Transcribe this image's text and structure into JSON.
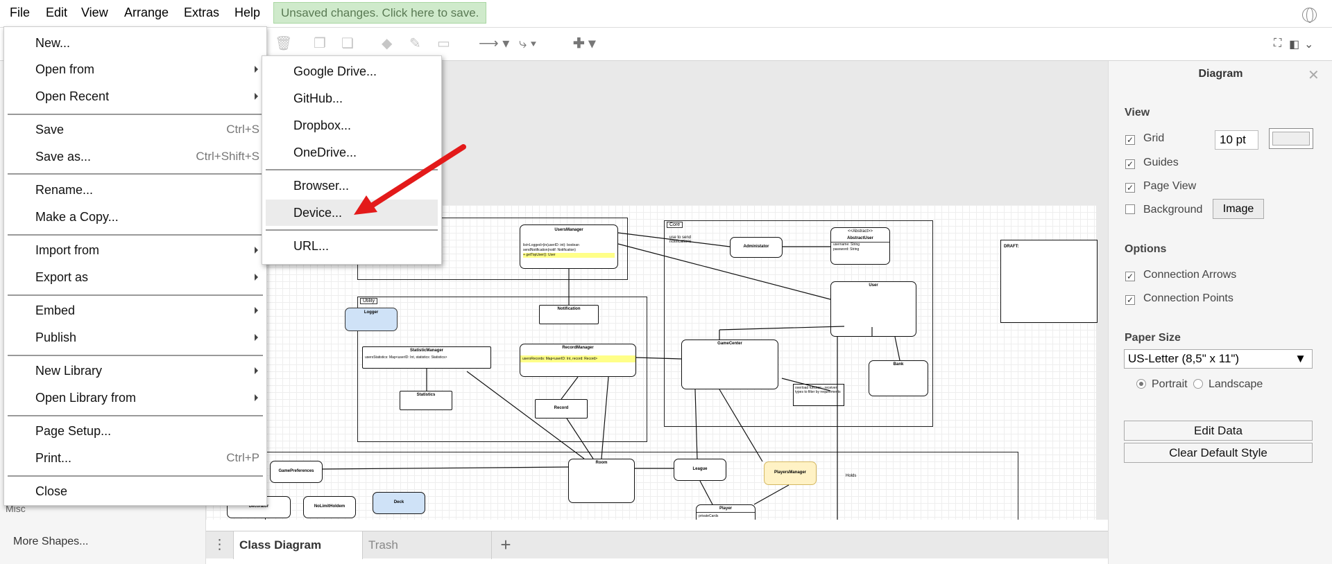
{
  "menubar": {
    "items": [
      "File",
      "Edit",
      "View",
      "Arrange",
      "Extras",
      "Help"
    ],
    "unsaved": "Unsaved changes. Click here to save."
  },
  "file_menu": {
    "new": "New...",
    "open_from": "Open from",
    "open_recent": "Open Recent",
    "save": "Save",
    "save_shortcut": "Ctrl+S",
    "save_as": "Save as...",
    "save_as_shortcut": "Ctrl+Shift+S",
    "rename": "Rename...",
    "make_copy": "Make a Copy...",
    "import_from": "Import from",
    "export_as": "Export as",
    "embed": "Embed",
    "publish": "Publish",
    "new_library": "New Library",
    "open_library_from": "Open Library from",
    "page_setup": "Page Setup...",
    "print": "Print...",
    "print_shortcut": "Ctrl+P",
    "close": "Close"
  },
  "open_from_submenu": {
    "google_drive": "Google Drive...",
    "github": "GitHub...",
    "dropbox": "Dropbox...",
    "onedrive": "OneDrive...",
    "browser": "Browser...",
    "device": "Device...",
    "url": "URL..."
  },
  "left_panel": {
    "misc": "Misc",
    "more_shapes": "More Shapes..."
  },
  "tabs": {
    "active": "Class Diagram",
    "inactive": "Trash"
  },
  "diagram": {
    "users_manager": "UsersManager",
    "users_manager_body": "list<Logged>(in(userID: int): boolean",
    "users_manager_body2": "sendNotification(notif: Notification)",
    "users_manager_body3": "+ getTopUser(): User",
    "core": "Core",
    "use_note": "use to send notifications",
    "administrator": "Administator",
    "abstract_user_stereo": "<<Abstract>>",
    "abstract_user": "AbstractUser",
    "abstract_user_body": "username: String\npassword: String",
    "utility": "Utility",
    "logger": "Logger",
    "notification": "Notification",
    "user": "User",
    "statistic_manager": "StatisticManager",
    "statistic_manager_body": "usersStatistics: Map<userID: Int, statistics: Statistics>",
    "record_manager": "RecordManager",
    "record_manager_body": "usersRecords: Map<userID: Int, record: Record>",
    "game_center": "GameCenter",
    "statistics": "Statistics",
    "record": "Record",
    "bank": "Bank",
    "overload_note": "overload function - receiver types to filter by requirements",
    "game_preferences": "GamePreferences",
    "room": "Room",
    "league": "League",
    "players_manager": "PlayersManager",
    "decorator": "Decorator",
    "no_limit_holdem": "NoLimitHoldem",
    "deck": "Deck",
    "player": "Player",
    "player_body": "privateCards",
    "holds": "Holds",
    "draft": "DRAFT:"
  },
  "right_panel": {
    "title": "Diagram",
    "view": "View",
    "grid": "Grid",
    "grid_size": "10 pt",
    "guides": "Guides",
    "page_view": "Page View",
    "background": "Background",
    "image_button": "Image",
    "options": "Options",
    "connection_arrows": "Connection Arrows",
    "connection_points": "Connection Points",
    "paper_size": "Paper Size",
    "paper_value": "US-Letter (8,5\" x 11\")",
    "portrait": "Portrait",
    "landscape": "Landscape",
    "edit_data": "Edit Data",
    "clear_default_style": "Clear Default Style",
    "grid_checked": true,
    "guides_checked": true,
    "page_view_checked": true,
    "background_checked": false,
    "connection_arrows_checked": true,
    "connection_points_checked": true,
    "orientation": "portrait"
  },
  "colors": {
    "unsaved_bg": "#cfeacb",
    "highlight_arrow": "#e31a1a",
    "logger_fill": "#cfe2f7",
    "players_manager_fill": "#fff2c5"
  }
}
